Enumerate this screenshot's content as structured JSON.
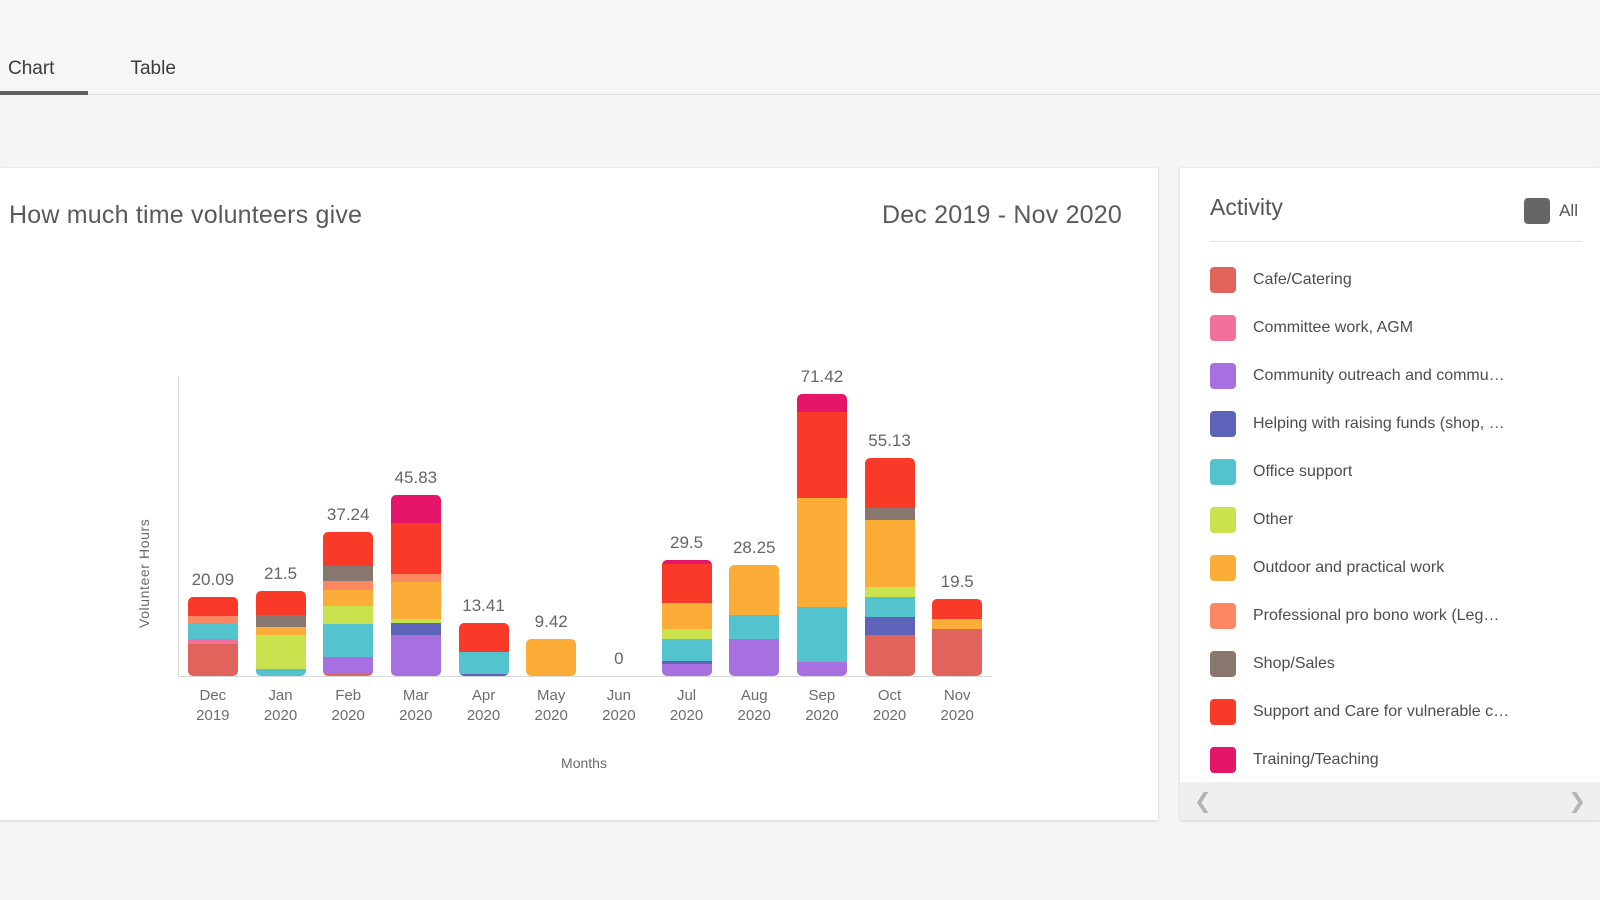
{
  "tabs": [
    {
      "label": "Chart",
      "active": true
    },
    {
      "label": "Table",
      "active": false
    }
  ],
  "chart_card": {
    "title": "How much time volunteers give",
    "range": "Dec 2019 - Nov 2020"
  },
  "legend": {
    "title": "Activity",
    "all_label": "All",
    "all_color": "#666666",
    "prev_icon": "chevron-left-icon",
    "next_icon": "chevron-right-icon",
    "items": [
      {
        "label": "Cafe/Catering",
        "color": "#E0645C"
      },
      {
        "label": "Committee work, AGM",
        "color": "#F2709C"
      },
      {
        "label": "Community outreach and commu…",
        "color": "#A86FE0"
      },
      {
        "label": "Helping with raising funds (shop, …",
        "color": "#5D63B8"
      },
      {
        "label": "Office support",
        "color": "#53C3CE"
      },
      {
        "label": "Other",
        "color": "#CBE24F"
      },
      {
        "label": "Outdoor and practical work",
        "color": "#FBAD38"
      },
      {
        "label": "Professional pro bono work (Leg…",
        "color": "#FC8863"
      },
      {
        "label": "Shop/Sales",
        "color": "#87776E"
      },
      {
        "label": "Support and Care for vulnerable c…",
        "color": "#F93A29"
      },
      {
        "label": "Training/Teaching",
        "color": "#E5166A"
      }
    ]
  },
  "chart_data": {
    "type": "bar",
    "stacked": true,
    "title": "How much time volunteers give",
    "subtitle": "Dec 2019 - Nov 2020",
    "xlabel": "Months",
    "ylabel": "Volunteer Hours",
    "ylim": [
      0,
      80
    ],
    "grid": false,
    "legend_position": "right",
    "categories": [
      "Dec\n2019",
      "Jan\n2020",
      "Feb\n2020",
      "Mar\n2020",
      "Apr\n2020",
      "May\n2020",
      "Jun\n2020",
      "Jul\n2020",
      "Aug\n2020",
      "Sep\n2020",
      "Oct\n2020",
      "Nov\n2020"
    ],
    "totals": [
      20.09,
      21.5,
      37.24,
      45.83,
      13.41,
      9.42,
      0,
      29.5,
      28.25,
      71.42,
      55.13,
      19.5
    ],
    "total_labels": [
      "20.09",
      "21.5",
      "37.24",
      "45.83",
      "13.41",
      "9.42",
      "0",
      "29.5",
      "28.25",
      "71.42",
      "55.13",
      "19.5"
    ],
    "series": [
      {
        "name": "Cafe/Catering",
        "color": "#E0645C",
        "values": [
          8.0,
          0,
          0.8,
          0,
          0,
          0,
          0,
          0,
          0,
          0,
          10.5,
          12.0
        ]
      },
      {
        "name": "Committee work, AGM",
        "color": "#F2709C",
        "values": [
          1.5,
          0,
          0,
          0,
          0,
          0,
          0,
          0,
          0,
          0,
          0,
          0
        ]
      },
      {
        "name": "Community outreach and communication",
        "color": "#A86FE0",
        "values": [
          0,
          0,
          4.0,
          10.5,
          0,
          0,
          0,
          3.0,
          9.5,
          3.5,
          0,
          0
        ]
      },
      {
        "name": "Helping with raising funds (shop, events)",
        "color": "#5D63B8",
        "values": [
          0,
          0,
          0,
          3.0,
          0.6,
          0,
          0,
          0.9,
          0,
          0,
          4.5,
          0
        ]
      },
      {
        "name": "Office support",
        "color": "#53C3CE",
        "values": [
          4.0,
          1.8,
          8.5,
          0,
          5.5,
          0,
          0,
          5.5,
          6.0,
          14.0,
          5.0,
          0
        ]
      },
      {
        "name": "Other",
        "color": "#CBE24F",
        "values": [
          0,
          8.5,
          4.5,
          0.9,
          0,
          0,
          0,
          2.5,
          0,
          0,
          2.5,
          0
        ]
      },
      {
        "name": "Outdoor and practical work",
        "color": "#FBAD38",
        "values": [
          0,
          2.0,
          4.0,
          9.5,
          0,
          9.42,
          0,
          6.5,
          12.75,
          27.5,
          17.0,
          2.5
        ]
      },
      {
        "name": "Professional pro bono work (Legal, IT)",
        "color": "#FC8863",
        "values": [
          1.6,
          0,
          2.2,
          1.9,
          0,
          0,
          0,
          0,
          0,
          0,
          0,
          0
        ]
      },
      {
        "name": "Shop/Sales",
        "color": "#87776E",
        "values": [
          0,
          3.2,
          4.0,
          0,
          0,
          0,
          0,
          0,
          0,
          0,
          3.0,
          0
        ]
      },
      {
        "name": "Support and Care for vulnerable clients",
        "color": "#F93A29",
        "values": [
          4.99,
          6.0,
          8.44,
          13.0,
          7.31,
          0,
          0,
          10.1,
          0,
          22.0,
          12.63,
          5.0
        ]
      },
      {
        "name": "Training/Teaching",
        "color": "#E5166A",
        "values": [
          0,
          0,
          0,
          7.03,
          0,
          0,
          0,
          1.0,
          0,
          4.42,
          0,
          0
        ]
      }
    ]
  }
}
